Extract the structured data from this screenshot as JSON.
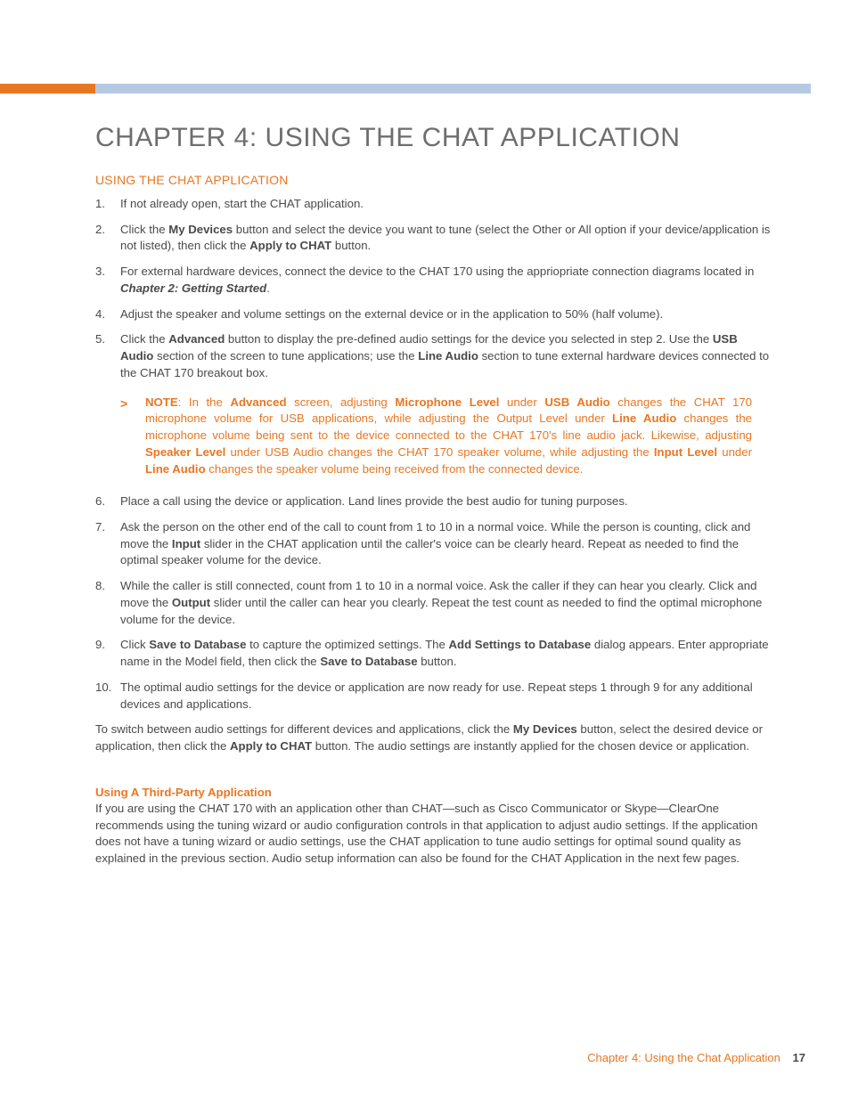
{
  "chapter_title": "CHAPTER 4: USING THE CHAT APPLICATION",
  "section_heading": "USING THE CHAT APPLICATION",
  "steps": {
    "s1": {
      "n": "1.",
      "t1": "If not already open, start the CHAT application."
    },
    "s2": {
      "n": "2.",
      "t1": "Click the ",
      "b1": "My Devices",
      "t2": " button and select the device you want to tune (select the Other or All option if your device/application is not listed), then click the ",
      "b2": "Apply to CHAT",
      "t3": " button."
    },
    "s3": {
      "n": "3.",
      "t1": "For external hardware devices, connect the device to the CHAT 170 using the appriopriate connection diagrams located in ",
      "b1": "Chapter 2: Getting Started",
      "t2": "."
    },
    "s4": {
      "n": "4.",
      "t1": "Adjust the speaker and volume settings on the external device or in the application to 50% (half volume)."
    },
    "s5": {
      "n": "5.",
      "t1": "Click the ",
      "b1": "Advanced",
      "t2": " button to display the pre-defined audio settings for the device you selected in step 2. Use the ",
      "b2": "USB Audio",
      "t3": " section of the screen to tune applications; use the ",
      "b3": "Line Audio",
      "t4": " section to tune external hardware devices connected to the CHAT 170 breakout box."
    },
    "s6": {
      "n": "6.",
      "t1": "Place a call using the device or application. Land lines provide the best audio for tuning purposes."
    },
    "s7": {
      "n": "7.",
      "t1": "Ask the person on the other end of the call to count from 1 to 10 in a normal voice. While the person is counting, click and move the ",
      "b1": "Input",
      "t2": " slider in the CHAT application until the caller's voice can be clearly heard. Repeat as needed to find the optimal speaker volume for the device."
    },
    "s8": {
      "n": "8.",
      "t1": "While the caller is still connected, count from 1 to 10 in a normal voice. Ask the caller if they can hear you clearly. Click and move the ",
      "b1": "Output",
      "t2": " slider until the caller can hear you clearly. Repeat the test count as needed to find the optimal microphone volume for the device."
    },
    "s9": {
      "n": "9.",
      "t1": "Click ",
      "b1": "Save to Database",
      "t2": " to capture the optimized settings. The ",
      "b2": "Add Settings to Database",
      "t3": " dialog appears. Enter appropriate name in the Model field, then click the ",
      "b3": "Save to Database",
      "t4": " button."
    },
    "s10": {
      "n": "10.",
      "t1": "The optimal audio settings for the device or application are now ready for use. Repeat steps 1 through 9 for any additional devices and applications."
    }
  },
  "note": {
    "chev": ">",
    "b0": "NOTE",
    "t0": ": In the ",
    "b1": "Advanced",
    "t1": " screen, adjusting ",
    "b2": "Microphone Level",
    "t2": " under ",
    "b3": "USB Audio",
    "t3": " changes the CHAT 170 microphone volume for USB applications, while adjusting the Output Level under ",
    "b4": "Line Audio",
    "t4": " changes the microphone volume being sent to the device connected to the CHAT 170's line audio jack. Likewise, adjusting ",
    "b5": "Speaker Level",
    "t5": " under USB Audio changes the CHAT 170 speaker volume, while adjusting the ",
    "b6": "Input Level",
    "t6": " under ",
    "b7": "Line Audio",
    "t7": " changes the speaker volume being received from the connected device."
  },
  "closing": {
    "t1": "To switch between audio settings for different devices and applications, click the ",
    "b1": "My Devices",
    "t2": " button, select the desired device or application, then click the ",
    "b2": "Apply to CHAT",
    "t3": " button. The audio settings are instantly applied for the chosen device or application."
  },
  "third": {
    "heading": "Using A Third-Party Application",
    "body": "If you are using the CHAT 170 with an application other than CHAT—such as Cisco Communicator or Skype—ClearOne recommends using the tuning wizard or audio configuration controls in that application to adjust audio settings. If the application does not have a tuning wizard or audio settings, use the CHAT application to tune audio settings for optimal sound quality as explained in the previous section. Audio setup information can also be found for the CHAT Application in the next few pages."
  },
  "footer": {
    "label": "Chapter 4: Using the Chat Application",
    "page": "17"
  }
}
